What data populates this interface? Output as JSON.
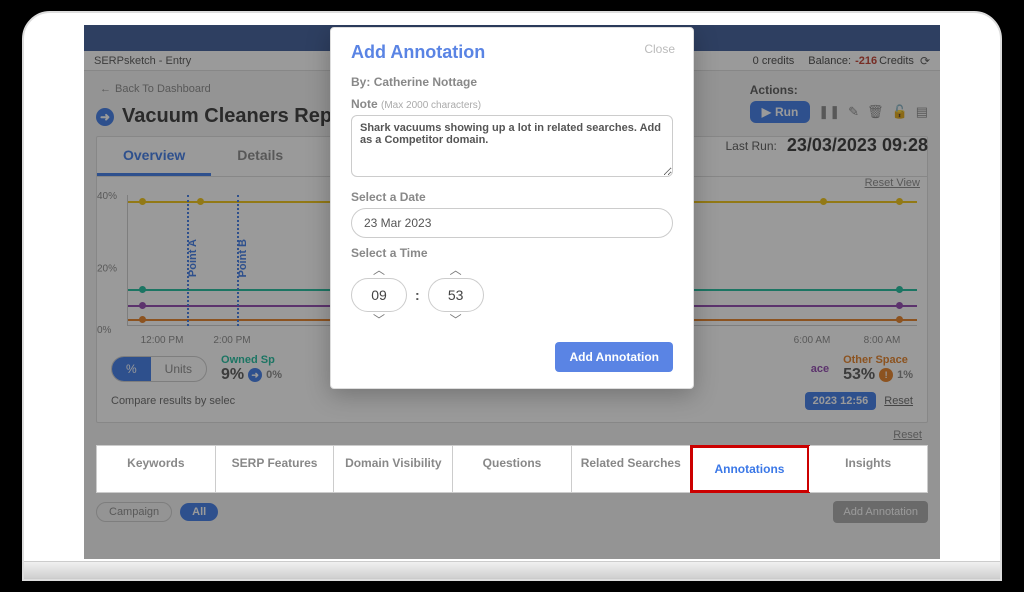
{
  "app": {
    "tag": "SERPsketch - Entry"
  },
  "balance": {
    "creditsLabel": "0 credits",
    "balanceLabel": "Balance:",
    "balanceValue": "-216",
    "balanceSuffix": "Credits"
  },
  "nav": {
    "back": "Back To Dashboard"
  },
  "pageTitle": "Vacuum Cleaners Rep",
  "actions": {
    "label": "Actions:",
    "run": "Run"
  },
  "lastRun": {
    "label": "Last Run:",
    "value": "23/03/2023 09:28"
  },
  "resetView": "Reset View",
  "tabs": {
    "overview": "Overview",
    "details": "Details"
  },
  "chart": {
    "xlabels": [
      "12:00 PM",
      "2:00 PM",
      "6:00 AM",
      "8:00 AM"
    ],
    "ylabels": [
      "0%",
      "20%",
      "40%"
    ],
    "markers": {
      "a": "Point A",
      "b": "Point B"
    }
  },
  "toggle": {
    "percent": "%",
    "units": "Units"
  },
  "stats": {
    "owned": {
      "label": "Owned Sp",
      "value": "9%",
      "change": "0%"
    },
    "space": {
      "label": "ace"
    },
    "other": {
      "label": "Other Space",
      "value": "53%",
      "change": "1%"
    }
  },
  "compare": {
    "text": "Compare results by selec",
    "timestamp": "2023 12:56",
    "reset": "Reset"
  },
  "bottomReset": "Reset",
  "bottomTabs": [
    "Keywords",
    "SERP Features",
    "Domain Visibility",
    "Questions",
    "Related Searches",
    "Annotations",
    "Insights"
  ],
  "filters": {
    "campaign": "Campaign",
    "all": "All",
    "addAnnotation": "Add Annotation"
  },
  "modal": {
    "title": "Add Annotation",
    "close": "Close",
    "byLabel": "By:",
    "byValue": "Catherine Nottage",
    "noteLabel": "Note",
    "noteHint": "(Max 2000 characters)",
    "noteValue": "Shark vacuums showing up a lot in related searches. Add as a Competitor domain.",
    "dateLabel": "Select a Date",
    "dateValue": "23 Mar 2023",
    "timeLabel": "Select a Time",
    "hour": "09",
    "minute": "53",
    "submit": "Add Annotation"
  }
}
